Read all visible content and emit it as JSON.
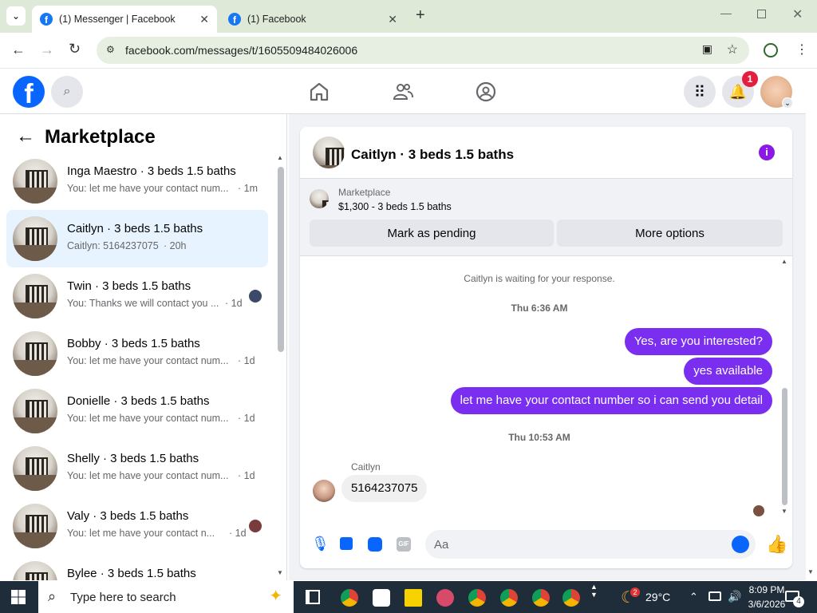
{
  "browser": {
    "tabs": [
      {
        "title": "(1) Messenger | Facebook"
      },
      {
        "title": "(1) Facebook"
      }
    ],
    "url": "facebook.com/messages/t/1605509484026006"
  },
  "fb": {
    "logo": "f",
    "notif_badge": "1"
  },
  "sidebar": {
    "title": "Marketplace",
    "items": [
      {
        "name": "Inga Maestro · 3 beds 1.5 baths",
        "preview": "You: let me have your contact num...",
        "time": "· 1m"
      },
      {
        "name": "Caitlyn · 3 beds 1.5 baths",
        "preview": "Caitlyn: 5164237075",
        "time": "· 20h"
      },
      {
        "name": "Twin · 3 beds 1.5 baths",
        "preview": "You: Thanks we will contact you ...",
        "time": "· 1d"
      },
      {
        "name": "Bobby · 3 beds 1.5 baths",
        "preview": "You: let me have your contact num...",
        "time": "· 1d"
      },
      {
        "name": "Donielle · 3 beds 1.5 baths",
        "preview": "You: let me have your contact num...",
        "time": "· 1d"
      },
      {
        "name": "Shelly · 3 beds 1.5 baths",
        "preview": "You: let me have your contact num...",
        "time": "· 1d"
      },
      {
        "name": "Valy · 3 beds 1.5 baths",
        "preview": "You: let me have your contact n...",
        "time": "· 1d"
      },
      {
        "name": "Bylee · 3 beds 1.5 baths",
        "preview": "",
        "time": ""
      }
    ]
  },
  "chat": {
    "title": "Caitlyn · 3 beds 1.5 baths",
    "listing_label": "Marketplace",
    "listing_info": "$1,300 - 3 beds 1.5 baths",
    "mark_pending": "Mark as pending",
    "more_options": "More options",
    "waiting": "Caitlyn is waiting for your response.",
    "ts1": "Thu 6:36 AM",
    "msg1": "Yes, are you interested?",
    "msg2": "yes available",
    "msg3": "let me have your contact number so i can send you detail",
    "ts2": "Thu 10:53 AM",
    "sender": "Caitlyn",
    "reply": "5164237075",
    "input_placeholder": "Aa",
    "gif_label": "GIF"
  },
  "taskbar": {
    "search_placeholder": "Type here to search",
    "weather": "29°C",
    "weather_badge": "2",
    "time": "8:09 PM",
    "date": "3/6/2026",
    "notif_count": "4"
  },
  "colors": {
    "accent": "#7a2ff0",
    "fb_blue": "#1877f2",
    "like": "#0866ff"
  }
}
